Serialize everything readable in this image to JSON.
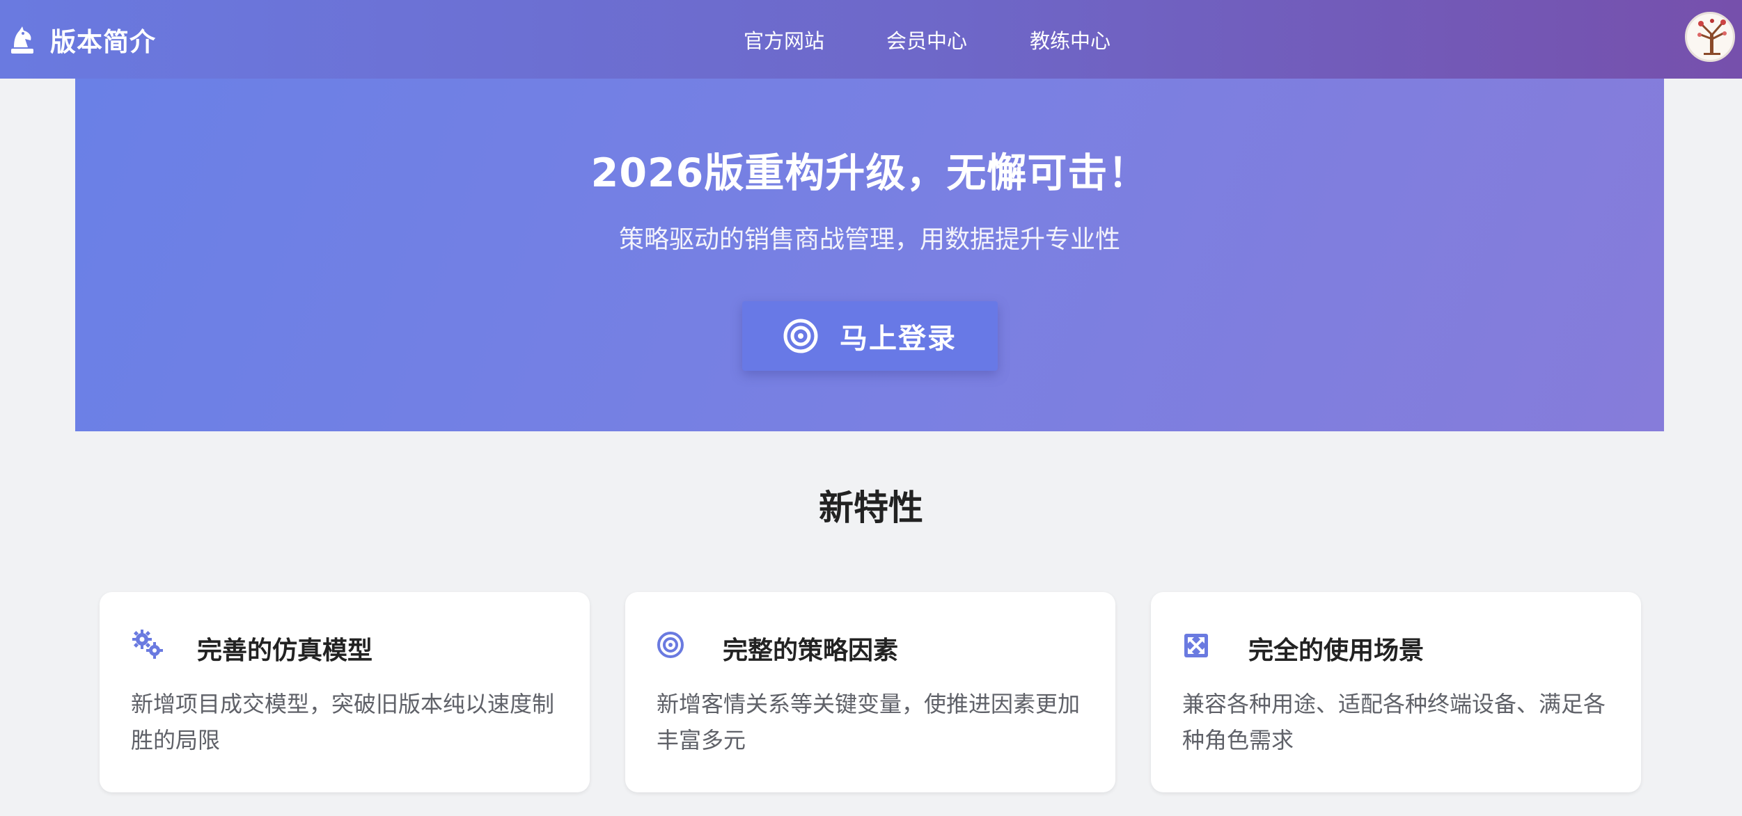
{
  "header": {
    "brand_title": "版本简介",
    "nav": [
      "官方网站",
      "会员中心",
      "教练中心"
    ]
  },
  "hero": {
    "title": "2026版重构升级，无懈可击！",
    "subtitle": "策略驱动的销售商战管理，用数据提升专业性",
    "login_label": "马上登录"
  },
  "features": {
    "title": "新特性",
    "cards": [
      {
        "icon": "gears-icon",
        "title": "完善的仿真模型",
        "desc": "新增项目成交模型，突破旧版本纯以速度制胜的局限"
      },
      {
        "icon": "target-icon",
        "title": "完整的策略因素",
        "desc": "新增客情关系等关键变量，使推进因素更加丰富多元"
      },
      {
        "icon": "expand-arrows-icon",
        "title": "完全的使用场景",
        "desc": "兼容各种用途、适配各种终端设备、满足各种角色需求"
      }
    ]
  },
  "colors": {
    "accent": "#6879e6",
    "icon": "#6a7ae0",
    "nav_start": "#6a7ae0",
    "nav_end": "#7650ac"
  }
}
